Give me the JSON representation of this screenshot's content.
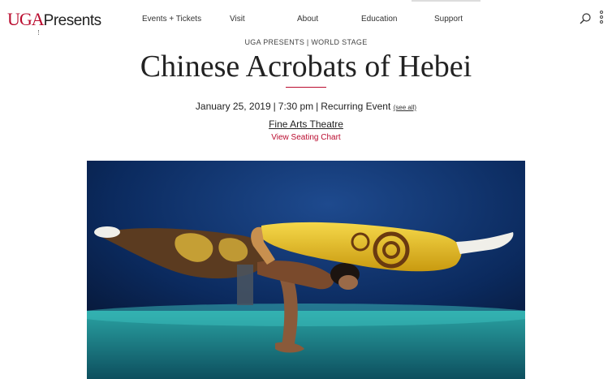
{
  "header": {
    "logo": {
      "uga": "UGA",
      "presents": "Presents"
    },
    "nav": [
      {
        "label": "Events + Tickets"
      },
      {
        "label": "Visit"
      },
      {
        "label": "About"
      },
      {
        "label": "Education"
      },
      {
        "label": "Support"
      }
    ],
    "icons": {
      "search": "search-icon",
      "more": "more-dots-icon"
    }
  },
  "event": {
    "eyebrow": "UGA PRESENTS | WORLD STAGE",
    "title": "Chinese Acrobats of Hebei",
    "date": "January 25, 2019",
    "time": "7:30 pm",
    "recurring": "Recurring Event",
    "see_all": "(see all)",
    "venue": "Fine Arts Theatre",
    "seating_chart": "View Seating Chart"
  },
  "colors": {
    "accent": "#ba0c2f",
    "text": "#222222",
    "stage_blue": "#0b2a5e",
    "stage_floor": "#1f8a8f",
    "costume_gold": "#e9c21b",
    "costume_brown": "#5b3b20"
  }
}
